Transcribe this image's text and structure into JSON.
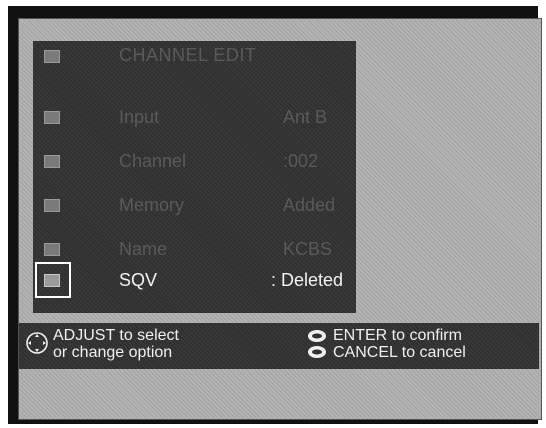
{
  "menu": {
    "title": "CHANNEL EDIT",
    "items": [
      {
        "label": "Input",
        "value": "Ant B"
      },
      {
        "label": "Channel",
        "value": ":002"
      },
      {
        "label": "Memory",
        "value": "Added"
      },
      {
        "label": "Name",
        "value": "KCBS"
      },
      {
        "label": "SQV",
        "value": ": Deleted"
      }
    ]
  },
  "help": {
    "adjust_line1": "ADJUST to select",
    "adjust_line2": "or change option",
    "enter_line": "ENTER to confirm",
    "cancel_line": "CANCEL to cancel"
  },
  "icons": {
    "title_icon": "menu-icon",
    "row_icon": "menu-item-icon",
    "adjust_icon": "joystick-icon",
    "enter_icon": "enter-button-icon",
    "cancel_icon": "cancel-button-icon"
  }
}
